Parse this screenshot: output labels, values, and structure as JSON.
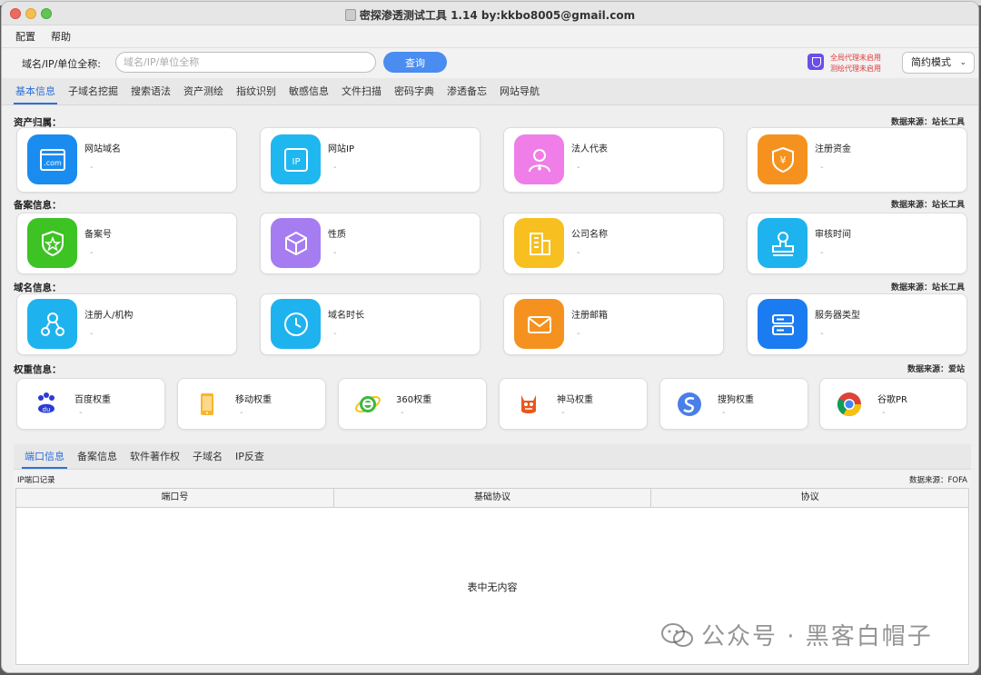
{
  "window": {
    "title": "密探渗透测试工具 1.14 by:kkbo8005@gmail.com"
  },
  "menu": [
    "配置",
    "帮助"
  ],
  "query": {
    "label": "域名/IP/单位全称:",
    "placeholder": "域名/IP/单位全称",
    "button": "查询",
    "proxy_global": "全局代理未启用",
    "proxy_test": "测绘代理未启用",
    "mode": "简约模式"
  },
  "tabs": [
    "基本信息",
    "子域名挖掘",
    "搜索语法",
    "资产测绘",
    "指纹识别",
    "敏感信息",
    "文件扫描",
    "密码字典",
    "渗透备忘",
    "网站导航"
  ],
  "sections": {
    "asset": {
      "title": "资产归属：",
      "source": "数据来源：站长工具"
    },
    "icp": {
      "title": "备案信息：",
      "source": "数据来源：站长工具"
    },
    "domain": {
      "title": "域名信息：",
      "source": "数据来源：站长工具"
    },
    "weight": {
      "title": "权重信息：",
      "source": "数据来源：爱站"
    }
  },
  "cards": {
    "site_domain": {
      "label": "网站域名",
      "value": "-"
    },
    "site_ip": {
      "label": "网站IP",
      "value": "-"
    },
    "legal_rep": {
      "label": "法人代表",
      "value": "-"
    },
    "reg_capital": {
      "label": "注册资金",
      "value": "-"
    },
    "icp_no": {
      "label": "备案号",
      "value": "-"
    },
    "nature": {
      "label": "性质",
      "value": "-"
    },
    "company": {
      "label": "公司名称",
      "value": "-"
    },
    "review_time": {
      "label": "审核时间",
      "value": "-"
    },
    "registrant": {
      "label": "注册人/机构",
      "value": "-"
    },
    "domain_age": {
      "label": "域名时长",
      "value": "-"
    },
    "reg_email": {
      "label": "注册邮箱",
      "value": "-"
    },
    "server_type": {
      "label": "服务器类型",
      "value": "-"
    },
    "baidu": {
      "label": "百度权重",
      "value": "-"
    },
    "mobile": {
      "label": "移动权重",
      "value": "-"
    },
    "w360": {
      "label": "360权重",
      "value": "-"
    },
    "shenma": {
      "label": "神马权重",
      "value": "-"
    },
    "sogou": {
      "label": "搜狗权重",
      "value": "-"
    },
    "google": {
      "label": "谷歌PR",
      "value": "-"
    }
  },
  "bottom": {
    "tabs": [
      "端口信息",
      "备案信息",
      "软件著作权",
      "子域名",
      "IP反查"
    ],
    "ip_label": "IP端口记录",
    "source": "数据来源：FOFA",
    "columns": [
      "端口号",
      "基础协议",
      "协议"
    ],
    "empty": "表中无内容"
  },
  "watermark": "公众号 · 黑客白帽子",
  "colors": {
    "accent": "#2f6fd6",
    "button": "#4a8cf0",
    "proxy_warning": "#e23a3a"
  }
}
